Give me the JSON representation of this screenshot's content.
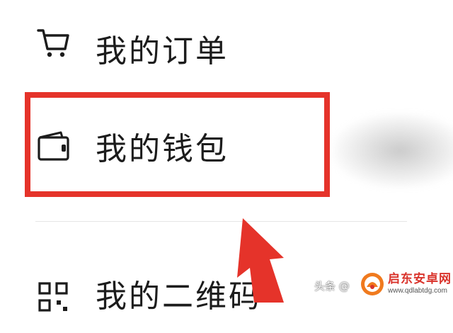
{
  "menu": {
    "items": [
      {
        "label": "我的订单",
        "icon": "cart-icon"
      },
      {
        "label": "我的钱包",
        "icon": "wallet-icon"
      },
      {
        "label": "我的二维码",
        "icon": "qrcode-icon"
      }
    ]
  },
  "annotation": {
    "highlight_color": "#e5332a",
    "arrow_color": "#e5332a"
  },
  "watermarks": {
    "left_text": "头条 @",
    "brand": "启东安卓网",
    "site": "www.qdlabtdg.com"
  }
}
